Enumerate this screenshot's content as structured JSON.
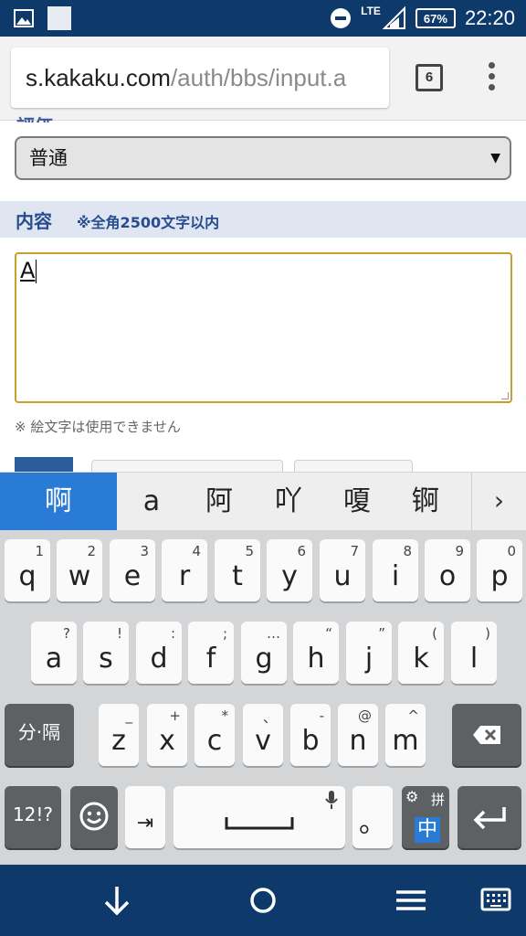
{
  "status_bar": {
    "network": "LTE",
    "battery": "67%",
    "time": "22:20"
  },
  "browser": {
    "url_host": "s.kakaku.com",
    "url_path": "/auth/bbs/input.a",
    "tab_count": "6"
  },
  "form": {
    "select_value": "普通",
    "select_arrow": "▼",
    "content_title": "内容",
    "content_note": "※全角2500文字以内",
    "textarea_value": "A",
    "emoji_notice": "※ 絵文字は使用できません"
  },
  "ime": {
    "candidates": [
      "啊",
      "a",
      "阿",
      "吖",
      "嗄",
      "锕"
    ],
    "more": "›"
  },
  "keyboard": {
    "row1": [
      {
        "key": "q",
        "hint": "1"
      },
      {
        "key": "w",
        "hint": "2"
      },
      {
        "key": "e",
        "hint": "3"
      },
      {
        "key": "r",
        "hint": "4"
      },
      {
        "key": "t",
        "hint": "5"
      },
      {
        "key": "y",
        "hint": "6"
      },
      {
        "key": "u",
        "hint": "7"
      },
      {
        "key": "i",
        "hint": "8"
      },
      {
        "key": "o",
        "hint": "9"
      },
      {
        "key": "p",
        "hint": "0"
      }
    ],
    "row2": [
      {
        "key": "a",
        "hint": "?"
      },
      {
        "key": "s",
        "hint": "!"
      },
      {
        "key": "d",
        "hint": ":"
      },
      {
        "key": "f",
        "hint": ";"
      },
      {
        "key": "g",
        "hint": "…"
      },
      {
        "key": "h",
        "hint": "“"
      },
      {
        "key": "j",
        "hint": "”"
      },
      {
        "key": "k",
        "hint": "("
      },
      {
        "key": "l",
        "hint": ")"
      }
    ],
    "row3": [
      {
        "key": "z",
        "hint": "_"
      },
      {
        "key": "x",
        "hint": "+"
      },
      {
        "key": "c",
        "hint": "*"
      },
      {
        "key": "v",
        "hint": "、"
      },
      {
        "key": "b",
        "hint": "-"
      },
      {
        "key": "n",
        "hint": "@"
      },
      {
        "key": "m",
        "hint": "^"
      }
    ],
    "split_label": "分·隔",
    "numbers_label": "12!?",
    "tab_label": "⇥",
    "period_label": "。",
    "lang_label": "中",
    "lang_hint": "拼"
  },
  "colors": {
    "system_bar": "#0d3a6b",
    "accent": "#2a7bd6",
    "section_text": "#274c8f",
    "textarea_border": "#c8a12a"
  }
}
